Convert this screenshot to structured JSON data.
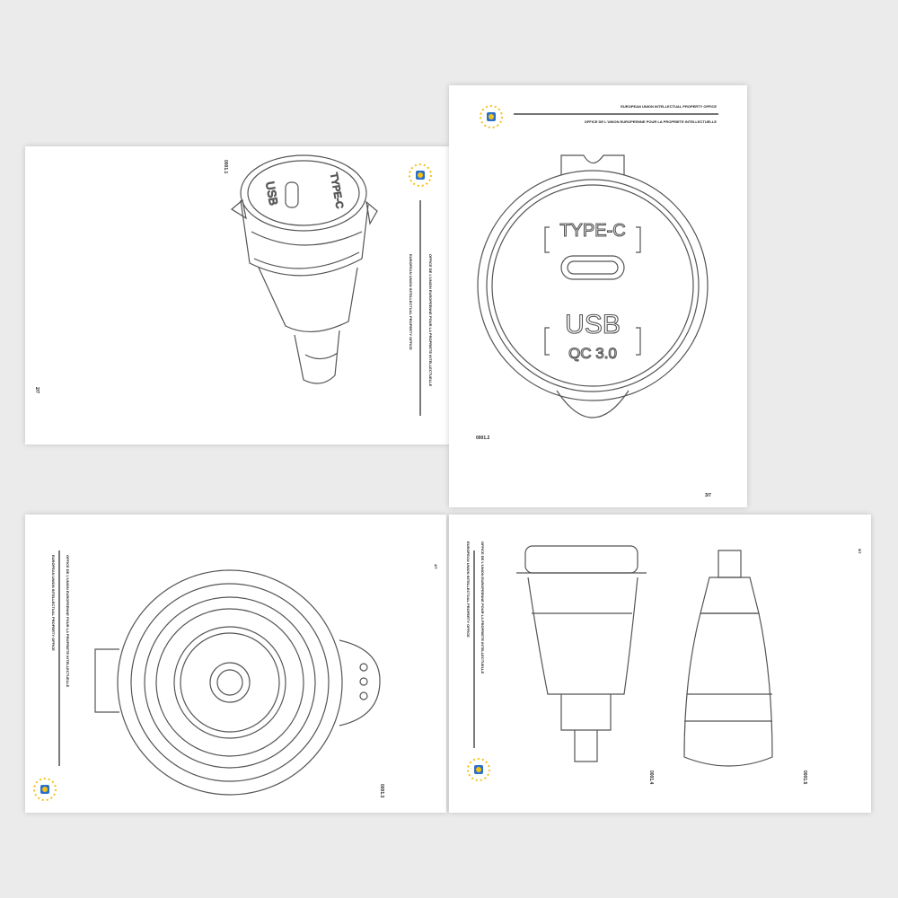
{
  "header": {
    "line1": "EUROPEAN UNION INTELLECTUAL PROPERTY OFFICE",
    "line2": "OFFICE DE L'UNION EUROPEENNE POUR LA PROPRIETE INTELLECTUELLE"
  },
  "pages": [
    {
      "figure": "0001.1",
      "page_number": "2/7"
    },
    {
      "figure": "0001.2",
      "page_number": "3/7",
      "labels": {
        "type_c": "TYPE-C",
        "usb": "USB",
        "qc": "QC 3.0"
      }
    },
    {
      "figure": "0001.3",
      "page_number": "4/7"
    },
    {
      "figure_a": "0001.4",
      "figure_b": "0001.5",
      "page_number": "5/7"
    }
  ],
  "colors": {
    "logo_blue": "#2a6fc9",
    "logo_yellow": "#f2c21b",
    "background": "#ebebeb"
  }
}
